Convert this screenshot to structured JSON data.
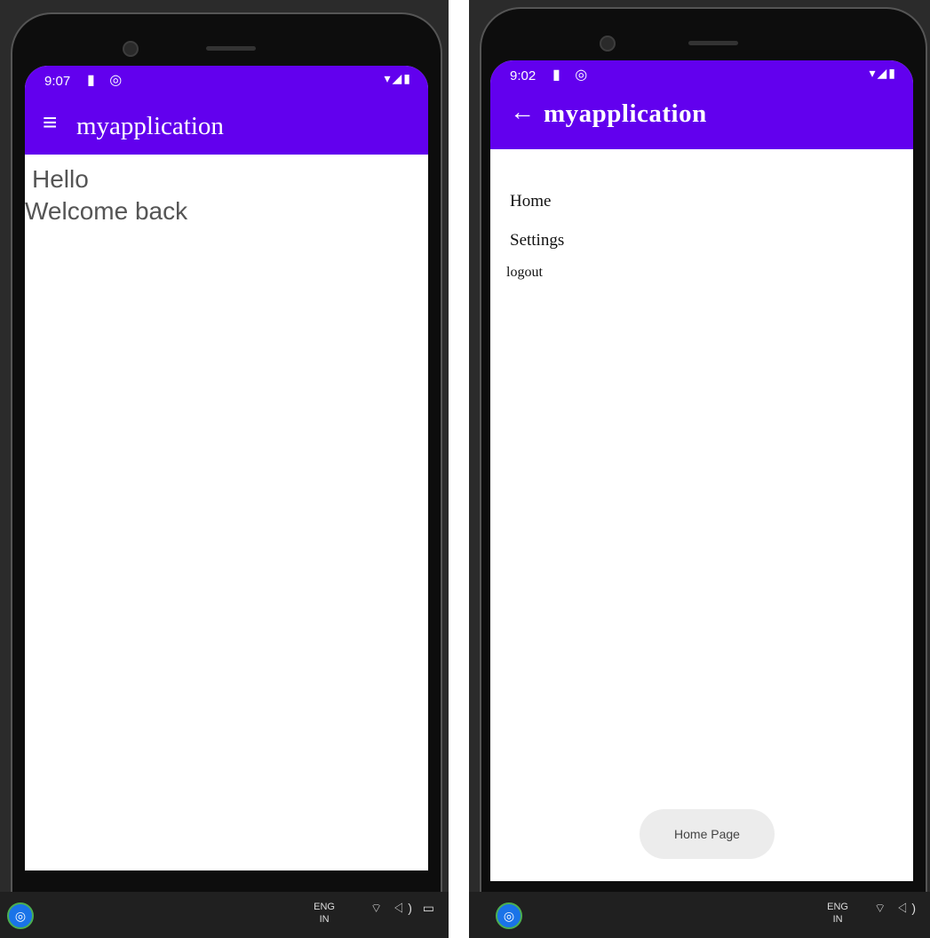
{
  "left_screen": {
    "status": {
      "time": "9:07",
      "left_icons": "▮ ◎",
      "right_icons": "▾◢▮"
    },
    "appbar": {
      "nav_icon": "≡",
      "title": "myapplication"
    },
    "content": {
      "greeting": "Hello",
      "subtitle": "Welcome back"
    },
    "taskbar": {
      "tray": "^ ◁) ",
      "lang_top": "ENG",
      "lang_bottom": "IN",
      "tray_right": "⌔ ◁) ▭"
    }
  },
  "right_screen": {
    "status": {
      "time": "9:02",
      "left_icons": "▮ ◎",
      "right_icons": "▾◢▮"
    },
    "appbar": {
      "nav_icon": "←",
      "title": "myapplication"
    },
    "menu": {
      "home": "Home",
      "settings": "Settings",
      "logout": "logout"
    },
    "toast": "Home Page",
    "taskbar": {
      "tray": "^ ◁)",
      "lang_top": "ENG",
      "lang_bottom": "IN",
      "tray_right": "⌔ ◁)"
    }
  },
  "colors": {
    "accent": "#6200ee"
  }
}
